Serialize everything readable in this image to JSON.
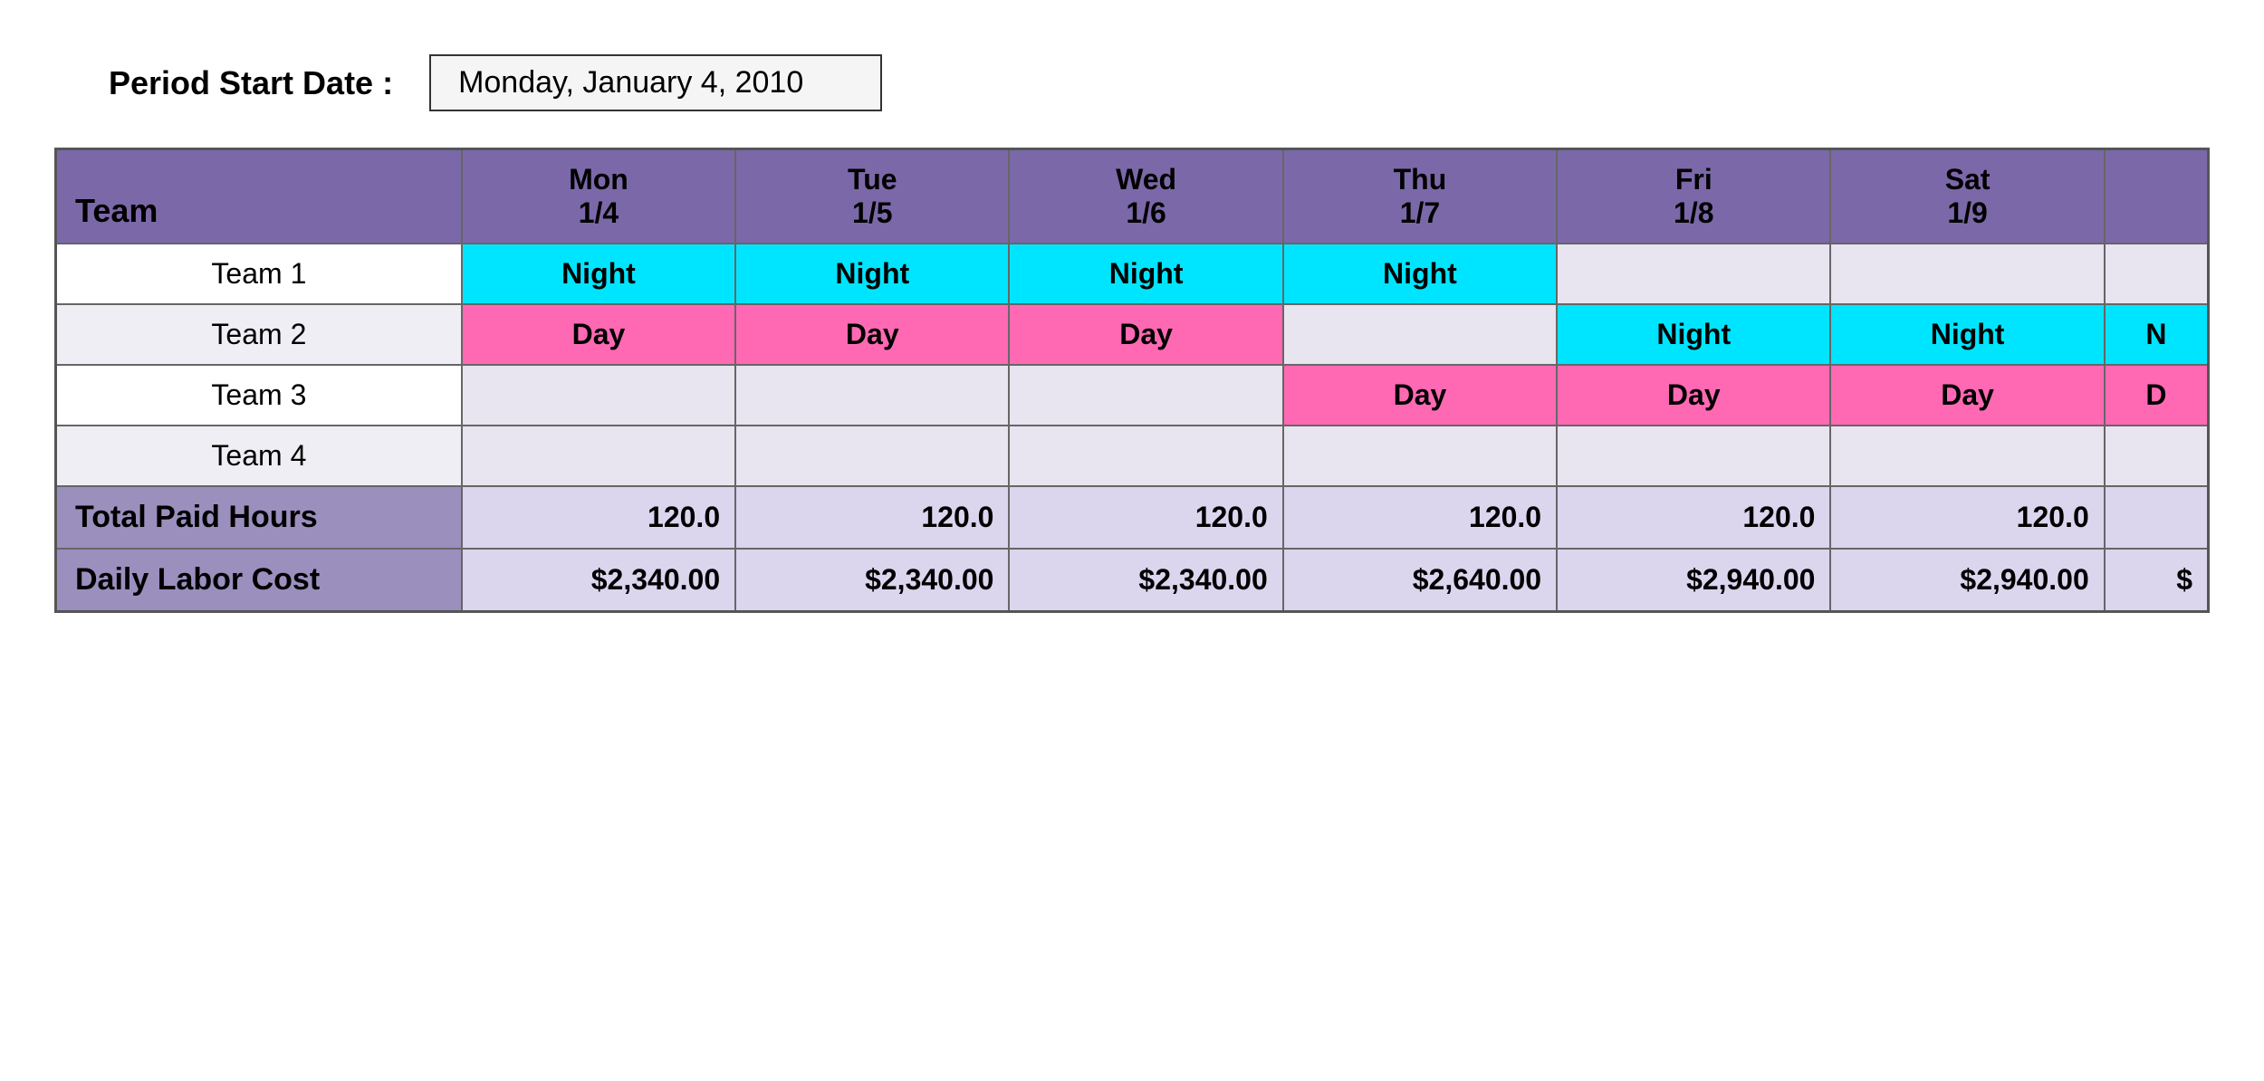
{
  "header": {
    "period_label": "Period Start Date :",
    "period_value": "Monday, January 4, 2010"
  },
  "table": {
    "columns": [
      {
        "label": "Team",
        "sub": "",
        "key": "team"
      },
      {
        "label": "Mon",
        "sub": "1/4",
        "key": "mon"
      },
      {
        "label": "Tue",
        "sub": "1/5",
        "key": "tue"
      },
      {
        "label": "Wed",
        "sub": "1/6",
        "key": "wed"
      },
      {
        "label": "Thu",
        "sub": "1/7",
        "key": "thu"
      },
      {
        "label": "Fri",
        "sub": "1/8",
        "key": "fri"
      },
      {
        "label": "Sat",
        "sub": "1/9",
        "key": "sat"
      },
      {
        "label": "",
        "sub": "",
        "key": "extra"
      }
    ],
    "teams": [
      {
        "name": "Team 1",
        "mon": "Night",
        "mon_type": "night",
        "tue": "Night",
        "tue_type": "night",
        "wed": "Night",
        "wed_type": "night",
        "thu": "Night",
        "thu_type": "night",
        "fri": "",
        "fri_type": "empty",
        "sat": "",
        "sat_type": "empty",
        "extra": "",
        "extra_type": "empty"
      },
      {
        "name": "Team 2",
        "mon": "Day",
        "mon_type": "day",
        "tue": "Day",
        "tue_type": "day",
        "wed": "Day",
        "wed_type": "day",
        "thu": "",
        "thu_type": "empty",
        "fri": "Night",
        "fri_type": "night",
        "sat": "Night",
        "sat_type": "night",
        "extra": "N",
        "extra_type": "night"
      },
      {
        "name": "Team 3",
        "mon": "",
        "mon_type": "empty",
        "tue": "",
        "tue_type": "empty",
        "wed": "",
        "wed_type": "empty",
        "thu": "Day",
        "thu_type": "day",
        "fri": "Day",
        "fri_type": "day",
        "sat": "Day",
        "sat_type": "day",
        "extra": "D",
        "extra_type": "day"
      },
      {
        "name": "Team 4",
        "mon": "",
        "mon_type": "empty",
        "tue": "",
        "tue_type": "empty",
        "wed": "",
        "wed_type": "empty",
        "thu": "",
        "thu_type": "empty",
        "fri": "",
        "fri_type": "empty",
        "sat": "",
        "sat_type": "empty",
        "extra": "",
        "extra_type": "empty"
      }
    ],
    "totals": {
      "paid_hours_label": "Total Paid Hours",
      "labor_cost_label": "Daily Labor Cost",
      "paid_hours": [
        "120.0",
        "120.0",
        "120.0",
        "120.0",
        "120.0",
        "120.0",
        ""
      ],
      "labor_cost": [
        "$2,340.00",
        "$2,340.00",
        "$2,340.00",
        "$2,640.00",
        "$2,940.00",
        "$2,940.00",
        "$"
      ]
    }
  }
}
